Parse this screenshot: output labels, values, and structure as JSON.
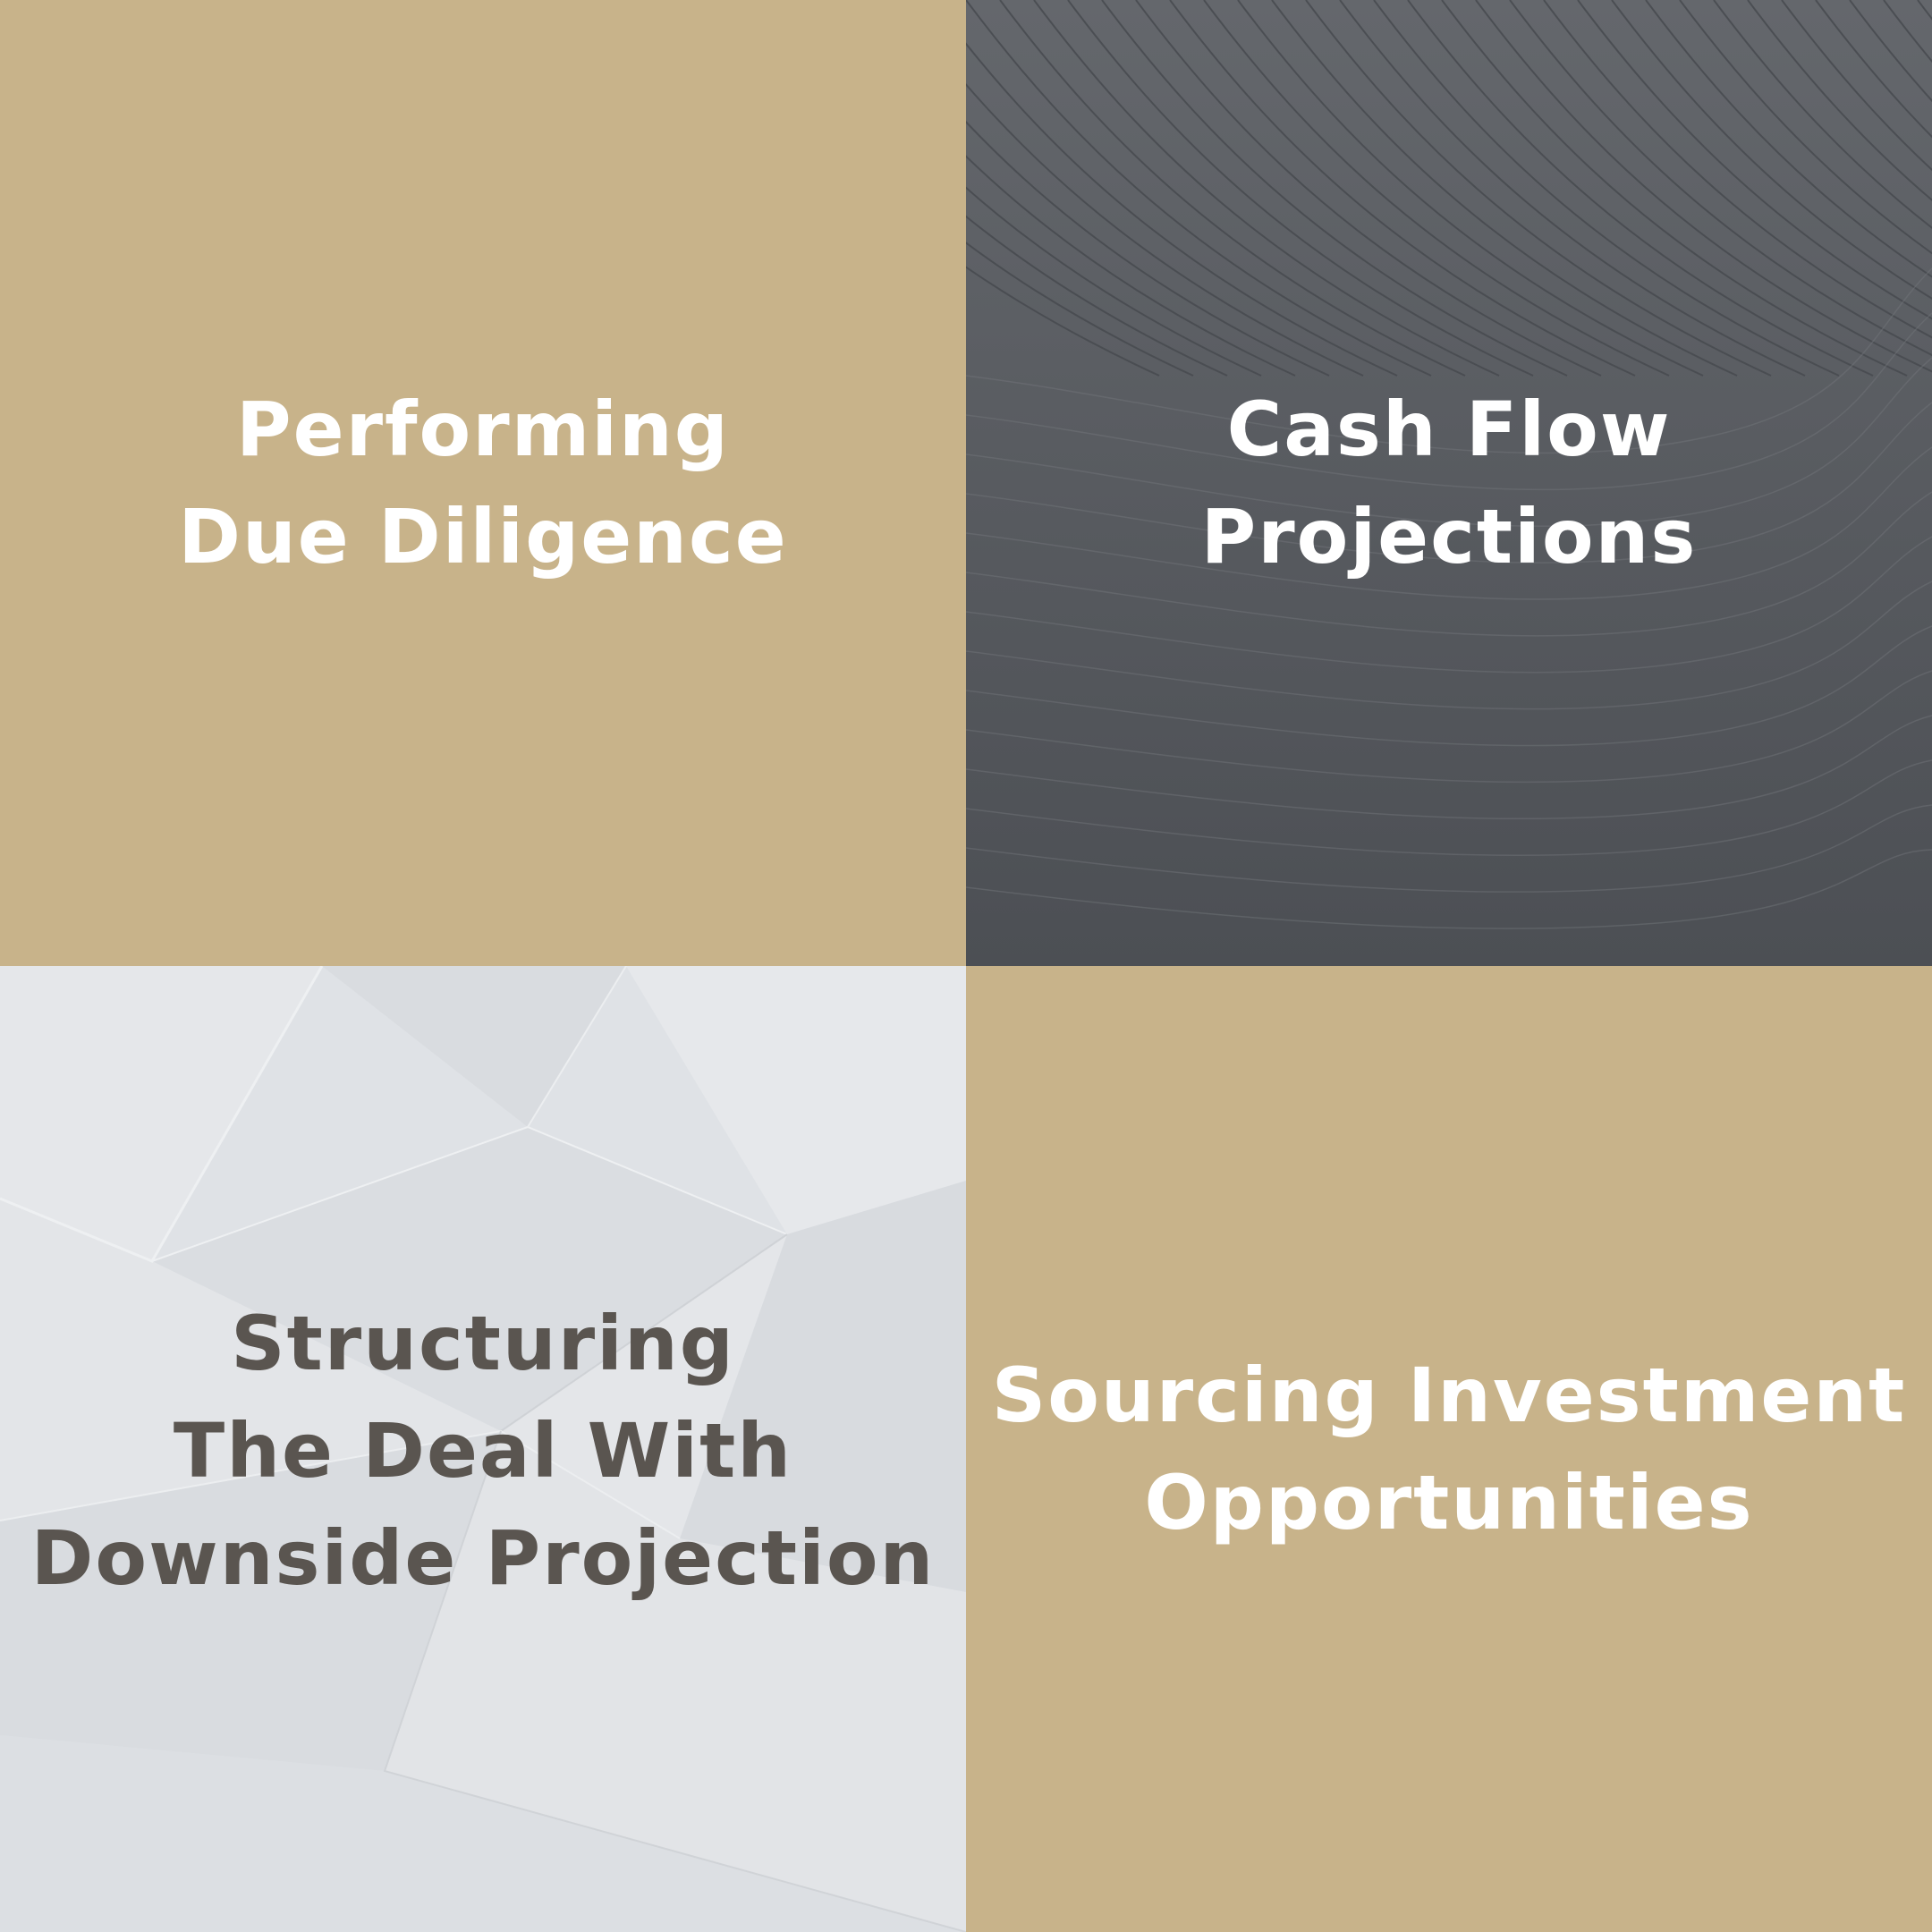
{
  "colors": {
    "tan": "#c8b38a",
    "charcoal": "#55585d",
    "light_gray": "#dfe2e6",
    "white_text": "#ffffff",
    "dark_text": "#5a5550"
  },
  "tiles": [
    {
      "lines": [
        "Performing",
        "Due Diligence"
      ]
    },
    {
      "lines": [
        "Cash Flow",
        "Projections"
      ]
    },
    {
      "lines": [
        "Structuring",
        "The Deal With",
        "Downside Projection"
      ]
    },
    {
      "lines": [
        "Sourcing Investment",
        "Opportunities"
      ]
    }
  ]
}
